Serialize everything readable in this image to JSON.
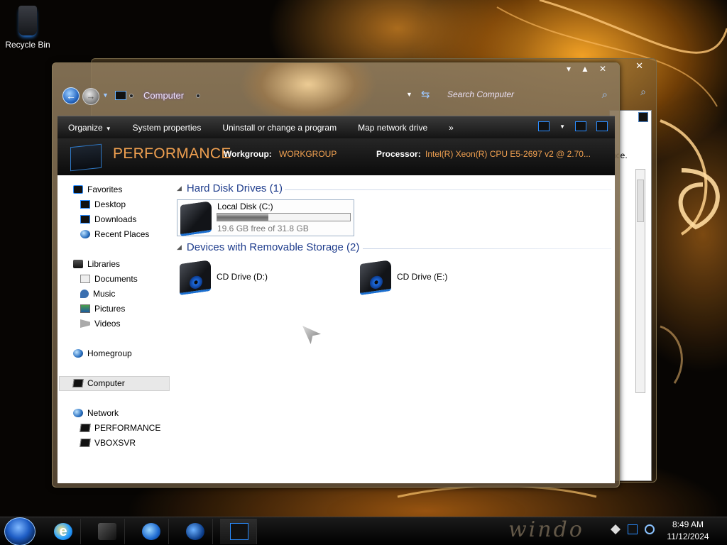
{
  "desktop": {
    "recycle_bin_label": "Recycle Bin"
  },
  "window": {
    "address": "Computer",
    "search_placeholder": "Search Computer",
    "caption_buttons": {
      "minimize": "▾",
      "maximize": "▲",
      "close": "✕"
    },
    "toolbar": {
      "organize": "Organize",
      "system_properties": "System properties",
      "uninstall": "Uninstall or change a program",
      "map_drive": "Map network drive",
      "more": "»"
    },
    "details": {
      "computer_name": "PERFORMANCE",
      "workgroup_label": "Workgroup:",
      "workgroup_value": "WORKGROUP",
      "processor_label": "Processor:",
      "processor_value": "Intel(R) Xeon(R) CPU E5-2697 v2 @ 2.70..."
    },
    "nav": {
      "favorites": "Favorites",
      "desktop": "Desktop",
      "downloads": "Downloads",
      "recent": "Recent Places",
      "libraries": "Libraries",
      "documents": "Documents",
      "music": "Music",
      "pictures": "Pictures",
      "videos": "Videos",
      "homegroup": "Homegroup",
      "computer": "Computer",
      "network": "Network",
      "net_pc1": "PERFORMANCE",
      "net_pc2": "VBOXSVR"
    },
    "groups": {
      "hard_disks": "Hard Disk Drives (1)",
      "removable": "Devices with Removable Storage (2)"
    },
    "drives": {
      "c_name": "Local Disk (C:)",
      "c_free": "19.6 GB free of 31.8 GB",
      "c_used_fraction": 0.384,
      "d_name": "CD Drive (D:)",
      "e_name": "CD Drive (E:)"
    }
  },
  "back_window": {
    "partial_text": "nce."
  },
  "taskbar": {
    "brand_text": "windo",
    "time": "8:49 AM",
    "date": "11/12/2024"
  }
}
